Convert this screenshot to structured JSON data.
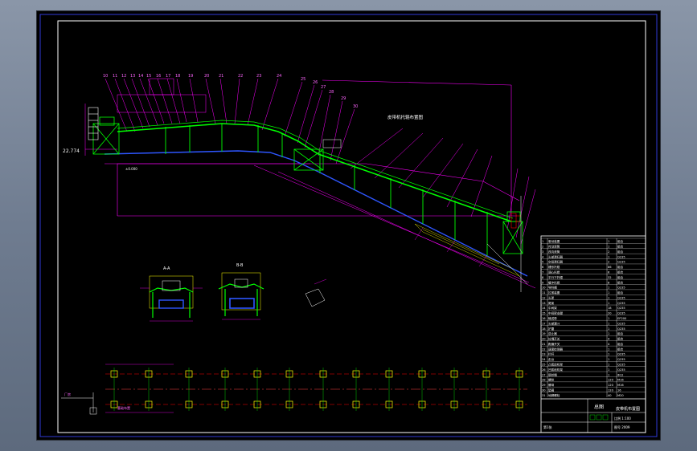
{
  "title_block": {
    "drawing_name": "皮带机布置图",
    "sheet_label": "总图",
    "scale_text": "比例 1:100",
    "sheet_no": "第1张",
    "footer_text": "图号 2009",
    "colors": {
      "frame": "#ffffff",
      "accent": "#00ff00"
    }
  },
  "annotations": {
    "upper_callout": "皮带机托辊布置图",
    "left_elevation": "22.774",
    "left_elev_small": "±0.000",
    "plan_label": "厂房",
    "plan_note": "基础布置",
    "section_a_label": "A-A",
    "section_b_label": "B-B"
  },
  "parts_table": {
    "rows": [
      [
        "1",
        "驱动装置",
        "1",
        "组合"
      ],
      [
        "2",
        "传动滚筒",
        "1",
        "组合"
      ],
      [
        "3",
        "改向滚筒",
        "2",
        "组合"
      ],
      [
        "4",
        "头部清扫器",
        "1",
        "Q235"
      ],
      [
        "5",
        "空段清扫器",
        "2",
        "Q235"
      ],
      [
        "6",
        "槽形托辊",
        "86",
        "组合"
      ],
      [
        "7",
        "调心托辊",
        "6",
        "组合"
      ],
      [
        "8",
        "平行下托辊",
        "32",
        "组合"
      ],
      [
        "9",
        "缓冲托辊",
        "8",
        "组合"
      ],
      [
        "10",
        "导料槽",
        "1",
        "Q235"
      ],
      [
        "11",
        "拉紧装置",
        "1",
        "组合"
      ],
      [
        "12",
        "头架",
        "1",
        "Q235"
      ],
      [
        "13",
        "尾架",
        "1",
        "Q235"
      ],
      [
        "14",
        "中间架",
        "18",
        "Q235"
      ],
      [
        "15",
        "中间架支腿",
        "20",
        "Q235"
      ],
      [
        "16",
        "输送带",
        "1",
        "EP200"
      ],
      [
        "17",
        "头部漏斗",
        "1",
        "Q235"
      ],
      [
        "18",
        "护罩",
        "1",
        "Q235"
      ],
      [
        "19",
        "逆止器",
        "1",
        "组合"
      ],
      [
        "20",
        "拉绳开关",
        "4",
        "组合"
      ],
      [
        "21",
        "跑偏开关",
        "4",
        "组合"
      ],
      [
        "22",
        "速度检测器",
        "1",
        "组合"
      ],
      [
        "23",
        "栏杆",
        "1",
        "Q235"
      ],
      [
        "24",
        "走台",
        "1",
        "Q235"
      ],
      [
        "25",
        "凸弧段机架",
        "1",
        "Q235"
      ],
      [
        "26",
        "凹弧段机架",
        "1",
        "Q235"
      ],
      [
        "27",
        "钢丝绳",
        "1",
        "Φ12"
      ],
      [
        "28",
        "螺栓",
        "120",
        "M16"
      ],
      [
        "29",
        "螺母",
        "120",
        "M16"
      ],
      [
        "30",
        "垫圈",
        "120",
        "16"
      ],
      [
        "31",
        "地脚螺栓",
        "40",
        "M20"
      ]
    ]
  }
}
